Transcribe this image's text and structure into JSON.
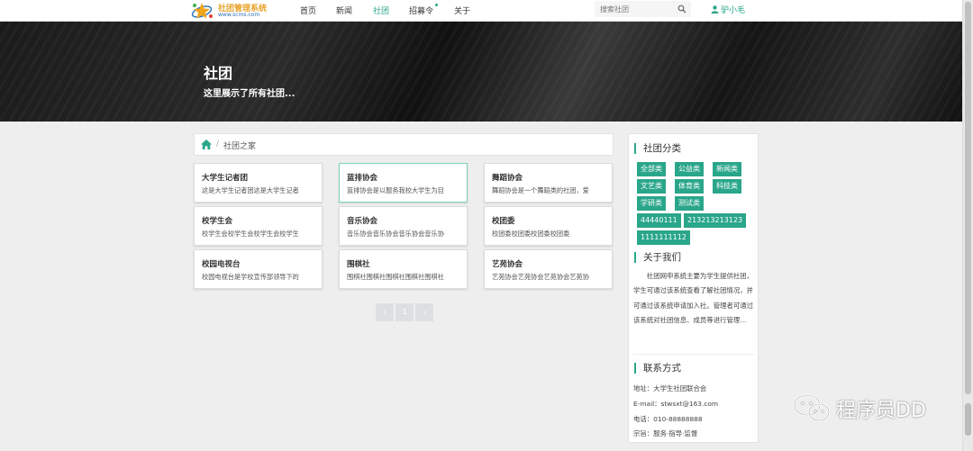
{
  "logo": {
    "title": "社团管理系统",
    "sub": "www.scms.com"
  },
  "nav": {
    "items": [
      {
        "label": "首页"
      },
      {
        "label": "新闻"
      },
      {
        "label": "社团"
      },
      {
        "label": "招募令"
      },
      {
        "label": "关于"
      }
    ],
    "active": "社团"
  },
  "search": {
    "placeholder": "搜索社团",
    "icon": "search-icon"
  },
  "user": {
    "name": "驴小毛",
    "icon": "user-icon"
  },
  "hero": {
    "title": "社团",
    "subtitle": "这里展示了所有社团..."
  },
  "breadcrumb": {
    "icon": "home-icon",
    "separator": "/",
    "current": "社团之家"
  },
  "clubs": [
    {
      "title": "大学生记者团",
      "desc": "这是大学生记者团这是大学生记者"
    },
    {
      "title": "蓝排协会",
      "desc": "篮排协会是以服务我校大学生为目"
    },
    {
      "title": "舞蹈协会",
      "desc": "舞蹈协会是一个舞蹈类的社团，爱"
    },
    {
      "title": "校学生会",
      "desc": "校学生会校学生会校学生会校学生"
    },
    {
      "title": "音乐协会",
      "desc": "音乐协会音乐协会音乐协会音乐协"
    },
    {
      "title": "校团委",
      "desc": "校团委校团委校团委校团委"
    },
    {
      "title": "校园电视台",
      "desc": "校园电视台是学校宣传部领导下的"
    },
    {
      "title": "围棋社",
      "desc": "围棋社围棋社围棋社围棋社围棋社"
    },
    {
      "title": "艺苑协会",
      "desc": "艺苑协会艺苑协会艺苑协会艺苑协"
    }
  ],
  "pager": {
    "prev": "‹",
    "page": "1",
    "next": "›"
  },
  "sidebar": {
    "category_title": "社团分类",
    "categories": [
      "全部类",
      "公益类",
      "新闻类",
      "文艺类",
      "体育类",
      "科技类",
      "学研类",
      "测试类",
      "44440111",
      "213213213123",
      "1111111112"
    ],
    "about_title": "关于我们",
    "about_text": "社团网申系统主要为学生提供社团，学生可通过该系统查看了解社团情况，并可通过该系统申请加入社。管理者可通过该系统对社团信息、成员等进行管理...",
    "contact_title": "联系方式",
    "contact": [
      "地址：大学生社团联合会",
      "E-mail：stwsxt@163.com",
      "电话：010-88888888",
      "宗旨：服务·指导·监督"
    ]
  },
  "watermark": {
    "text": "程序员DD"
  },
  "colors": {
    "accent": "#2aa68a",
    "hero_bg": "#1b1b1b",
    "page_bg": "#eeeeee"
  }
}
